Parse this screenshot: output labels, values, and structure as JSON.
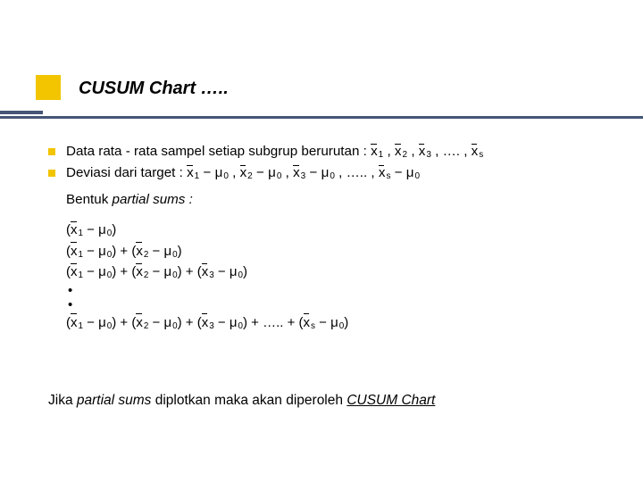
{
  "title": "CUSUM Chart …..",
  "line1_pre": "Data rata - rata sampel setiap subgrup berurutan :",
  "line2_pre": "Deviasi dari target :",
  "x": "x",
  "mu": "μ",
  "sub1": "1",
  "sub2": "2",
  "sub3": "3",
  "subs": "s",
  "sub0": "0",
  "comma": " , ",
  "ell4": " , …. , ",
  "ell5": " , ….. , ",
  "minus": " − ",
  "plus": " + ",
  "lp": "(",
  "rp": ")",
  "elltrail": " + ….. + ",
  "bentuk_pre": "Bentuk ",
  "bentuk_it": "partial sums :",
  "dot": "•",
  "footer_a": "Jika ",
  "footer_it": "partial sums",
  "footer_b": " diplotkan maka akan diperoleh ",
  "footer_c": "CUSUM Chart"
}
